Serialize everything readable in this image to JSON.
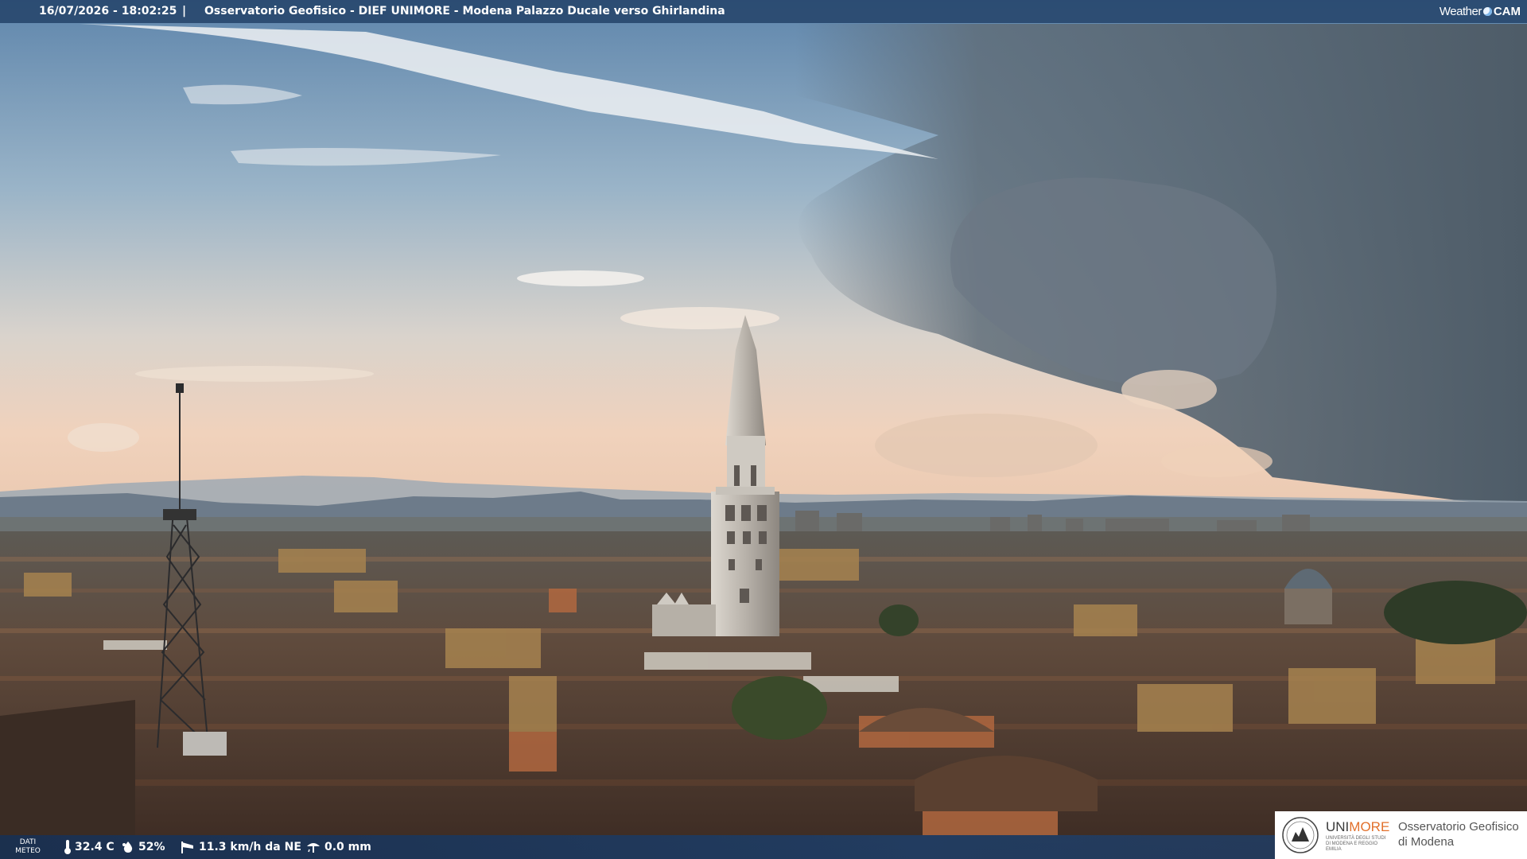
{
  "overlay": {
    "timestamp": "16/07/2026 - 18:02:25",
    "separator": "|",
    "caption": "Osservatorio Geofisico - DIEF UNIMORE - Modena Palazzo Ducale verso Ghirlandina",
    "brand_weather": "Weather",
    "brand_cam": "CAM"
  },
  "weather": {
    "label_line1": "DATI",
    "label_line2": "METEO",
    "temperature": "32.4 C",
    "humidity": "52%",
    "wind": "11.3 km/h da NE",
    "rain": "0.0 mm",
    "icons": [
      "thermometer-icon",
      "humidity-drop-icon",
      "wind-sock-icon",
      "rain-gauge-icon"
    ]
  },
  "logo": {
    "unimore_a": "UNI",
    "unimore_b": "MORE",
    "unimore_sub": "UNIVERSITÀ DEGLI STUDI DI MODENA E REGGIO EMILIA",
    "obs_line1": "Osservatorio Geofisico",
    "obs_line2": "di Modena"
  },
  "colors": {
    "bar": "#28486e",
    "unimore_accent": "#e2702b"
  }
}
